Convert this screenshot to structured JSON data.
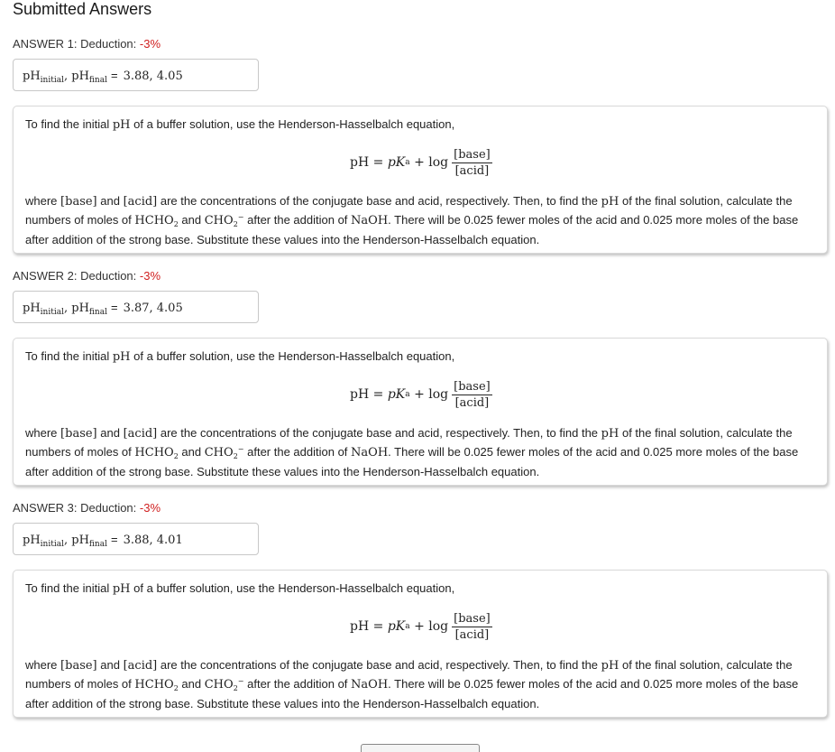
{
  "page": {
    "title": "Submitted Answers"
  },
  "answers": [
    {
      "label": "ANSWER 1: Deduction: ",
      "deduction": "-3%",
      "response": {
        "ph": "pH",
        "initial_sub": "initial",
        "sep": ",",
        "final_sub": "final",
        "eq": "=",
        "value": "3.88, 4.05"
      },
      "feedback": {
        "intro": "To find the initial",
        "intro_math": "pH",
        "intro_end": "of a buffer solution, use the Henderson-Hasselbalch equation,",
        "equation": {
          "lhs": "pH",
          "equals": "=",
          "pK": "pK",
          "a_sub": "a",
          "plus": "+",
          "log": "log",
          "numerator": "[base]",
          "denominator": "[acid]"
        },
        "where": "where",
        "base": "[base]",
        "and1": "and",
        "acid": "[acid]",
        "text1": "are the concentrations of the conjugate base and acid, respectively. Then, to find the",
        "ph2": "pH",
        "text2": "of the final solution, calculate the numbers of moles of",
        "hcho2": "HCHO",
        "hcho2_sub": "2",
        "and2": "and",
        "cho2": "CHO",
        "cho2_sub": "2",
        "cho2_sup": "−",
        "text3": "after the addition of",
        "naoh": "NaOH",
        "text4": ". There will be 0.025 fewer moles of the acid and 0.025 more moles of the base after addition of the strong base. Substitute these values into the Henderson-Hasselbalch equation."
      }
    },
    {
      "label": "ANSWER 2: Deduction: ",
      "deduction": "-3%",
      "response": {
        "ph": "pH",
        "initial_sub": "initial",
        "sep": ",",
        "final_sub": "final",
        "eq": "=",
        "value": "3.87, 4.05"
      },
      "feedback": {
        "intro": "To find the initial",
        "intro_math": "pH",
        "intro_end": "of a buffer solution, use the Henderson-Hasselbalch equation,",
        "equation": {
          "lhs": "pH",
          "equals": "=",
          "pK": "pK",
          "a_sub": "a",
          "plus": "+",
          "log": "log",
          "numerator": "[base]",
          "denominator": "[acid]"
        },
        "where": "where",
        "base": "[base]",
        "and1": "and",
        "acid": "[acid]",
        "text1": "are the concentrations of the conjugate base and acid, respectively. Then, to find the",
        "ph2": "pH",
        "text2": "of the final solution, calculate the numbers of moles of",
        "hcho2": "HCHO",
        "hcho2_sub": "2",
        "and2": "and",
        "cho2": "CHO",
        "cho2_sub": "2",
        "cho2_sup": "−",
        "text3": "after the addition of",
        "naoh": "NaOH",
        "text4": ". There will be 0.025 fewer moles of the acid and 0.025 more moles of the base after addition of the strong base. Substitute these values into the Henderson-Hasselbalch equation."
      }
    },
    {
      "label": "ANSWER 3: Deduction: ",
      "deduction": "-3%",
      "response": {
        "ph": "pH",
        "initial_sub": "initial",
        "sep": ",",
        "final_sub": "final",
        "eq": "=",
        "value": "3.88, 4.01"
      },
      "feedback": {
        "intro": "To find the initial",
        "intro_math": "pH",
        "intro_end": "of a buffer solution, use the Henderson-Hasselbalch equation,",
        "equation": {
          "lhs": "pH",
          "equals": "=",
          "pK": "pK",
          "a_sub": "a",
          "plus": "+",
          "log": "log",
          "numerator": "[base]",
          "denominator": "[acid]"
        },
        "where": "where",
        "base": "[base]",
        "and1": "and",
        "acid": "[acid]",
        "text1": "are the concentrations of the conjugate base and acid, respectively. Then, to find the",
        "ph2": "pH",
        "text2": "of the final solution, calculate the numbers of moles of",
        "hcho2": "HCHO",
        "hcho2_sub": "2",
        "and2": "and",
        "cho2": "CHO",
        "cho2_sub": "2",
        "cho2_sup": "−",
        "text3": "after the addition of",
        "naoh": "NaOH",
        "text4": ". There will be 0.025 fewer moles of the acid and 0.025 more moles of the base after addition of the strong base. Substitute these values into the Henderson-Hasselbalch equation."
      }
    }
  ]
}
